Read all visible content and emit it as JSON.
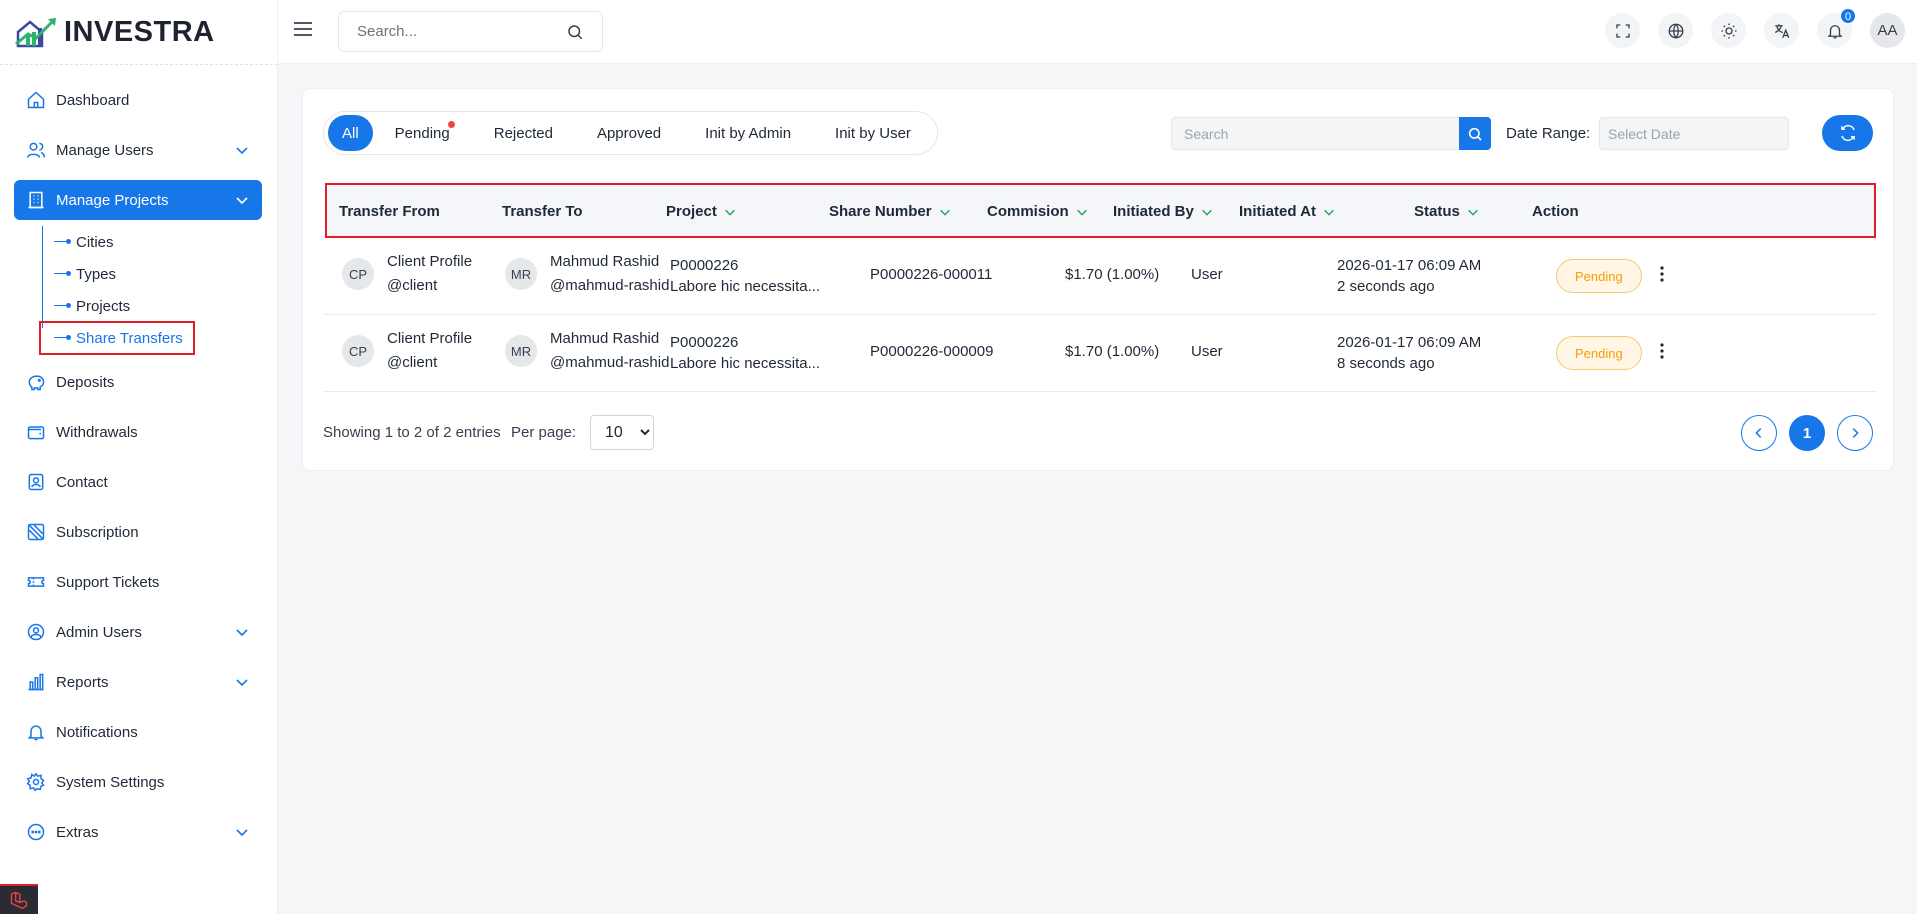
{
  "app": {
    "name": "INVESTRA"
  },
  "sidebar": {
    "items": [
      {
        "label": "Dashboard",
        "icon": "home-icon"
      },
      {
        "label": "Manage Users",
        "icon": "users-icon",
        "expandable": true
      },
      {
        "label": "Manage Projects",
        "icon": "building-icon",
        "expandable": true,
        "active": true
      },
      {
        "label": "Deposits",
        "icon": "piggy-bank-icon"
      },
      {
        "label": "Withdrawals",
        "icon": "wallet-icon"
      },
      {
        "label": "Contact",
        "icon": "contact-icon"
      },
      {
        "label": "Subscription",
        "icon": "subscription-icon"
      },
      {
        "label": "Support Tickets",
        "icon": "ticket-icon"
      },
      {
        "label": "Admin Users",
        "icon": "admin-user-icon",
        "expandable": true
      },
      {
        "label": "Reports",
        "icon": "chart-icon",
        "expandable": true
      },
      {
        "label": "Notifications",
        "icon": "bell-icon"
      },
      {
        "label": "System Settings",
        "icon": "gear-icon"
      },
      {
        "label": "Extras",
        "icon": "dots-circle-icon",
        "expandable": true
      }
    ],
    "submenu": [
      "Cities",
      "Types",
      "Projects",
      "Share Transfers"
    ]
  },
  "topbar": {
    "search_placeholder": "Search...",
    "notification_count": "0",
    "avatar_initials": "AA"
  },
  "filters": {
    "tabs": [
      "All",
      "Pending",
      "Rejected",
      "Approved",
      "Init by Admin",
      "Init by User"
    ],
    "search_placeholder": "Search",
    "date_label": "Date Range:",
    "date_placeholder": "Select Date"
  },
  "table": {
    "headers": [
      "Transfer From",
      "Transfer To",
      "Project",
      "Share Number",
      "Commision",
      "Initiated By",
      "Initiated At",
      "Status",
      "Action"
    ],
    "rows": [
      {
        "from": {
          "initials": "CP",
          "name": "Client Profile",
          "handle": "@client"
        },
        "to": {
          "initials": "MR",
          "name": "Mahmud Rashid",
          "handle": "@mahmud-rashid"
        },
        "project_code": "P0000226",
        "project_desc": "Labore hic necessita...",
        "share_number": "P0000226-000011",
        "commission": "$1.70 (1.00%)",
        "initiated_by": "User",
        "initiated_at": "2026-01-17 06:09 AM",
        "initiated_ago": "2 seconds ago",
        "status": "Pending"
      },
      {
        "from": {
          "initials": "CP",
          "name": "Client Profile",
          "handle": "@client"
        },
        "to": {
          "initials": "MR",
          "name": "Mahmud Rashid",
          "handle": "@mahmud-rashid"
        },
        "project_code": "P0000226",
        "project_desc": "Labore hic necessita...",
        "share_number": "P0000226-000009",
        "commission": "$1.70 (1.00%)",
        "initiated_by": "User",
        "initiated_at": "2026-01-17 06:09 AM",
        "initiated_ago": "8 seconds ago",
        "status": "Pending"
      }
    ]
  },
  "footer": {
    "showing": "Showing 1 to 2 of 2 entries",
    "per_page_label": "Per page:",
    "per_page_value": "10",
    "current_page": "1"
  },
  "colors": {
    "primary": "#1877e8",
    "highlight": "#e11d2a",
    "pending": "#f59e0b"
  }
}
